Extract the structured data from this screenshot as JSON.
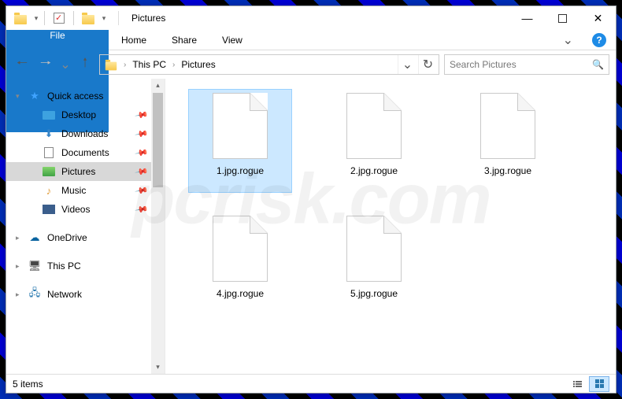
{
  "window": {
    "title": "Pictures"
  },
  "ribbon": {
    "file": "File",
    "tabs": [
      "Home",
      "Share",
      "View"
    ]
  },
  "breadcrumb": {
    "items": [
      "This PC",
      "Pictures"
    ]
  },
  "search": {
    "placeholder": "Search Pictures"
  },
  "navpane": {
    "quick_access": "Quick access",
    "pinned": [
      {
        "label": "Desktop",
        "icon": "desktop"
      },
      {
        "label": "Downloads",
        "icon": "downloads"
      },
      {
        "label": "Documents",
        "icon": "documents"
      },
      {
        "label": "Pictures",
        "icon": "pictures",
        "selected": true
      },
      {
        "label": "Music",
        "icon": "music"
      },
      {
        "label": "Videos",
        "icon": "videos"
      }
    ],
    "onedrive": "OneDrive",
    "this_pc": "This PC",
    "network": "Network"
  },
  "files": [
    {
      "name": "1.jpg.rogue",
      "selected": true
    },
    {
      "name": "2.jpg.rogue"
    },
    {
      "name": "3.jpg.rogue"
    },
    {
      "name": "4.jpg.rogue"
    },
    {
      "name": "5.jpg.rogue"
    }
  ],
  "status": {
    "count_label": "5 items"
  },
  "watermark": "pcrisk.com"
}
